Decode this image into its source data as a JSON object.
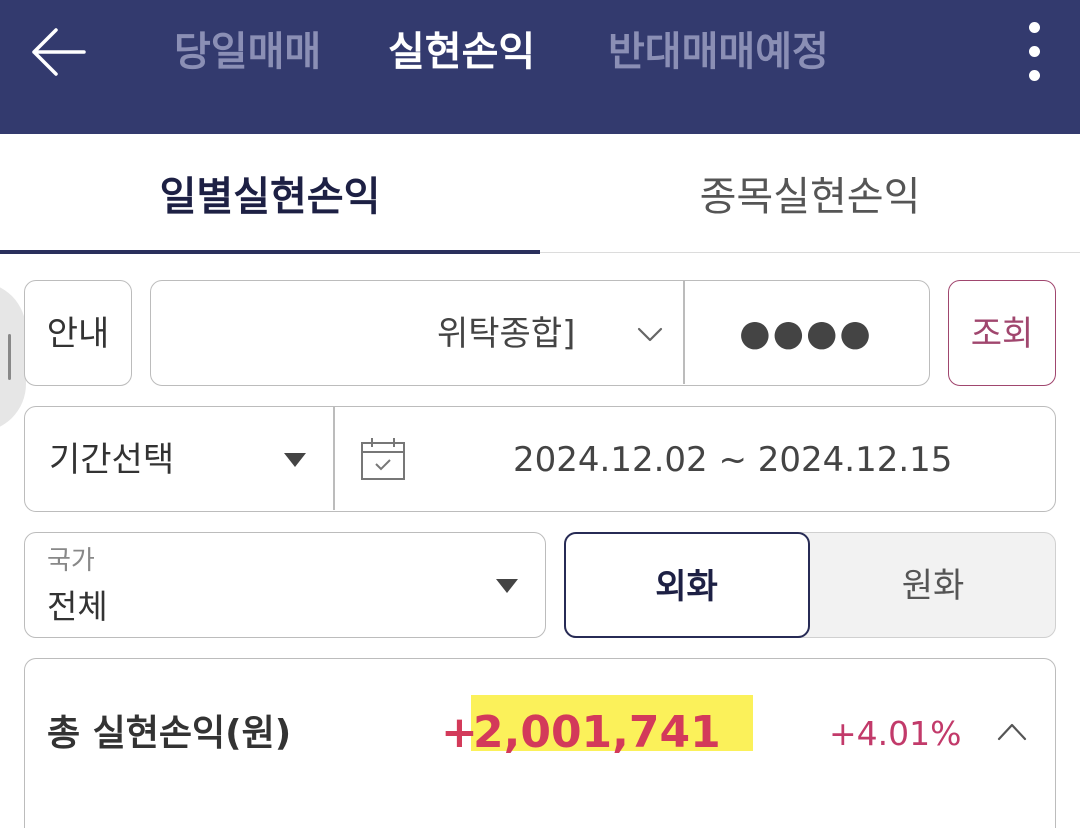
{
  "top_tabs": [
    "당일매매",
    "실현손익",
    "반대매매예정"
  ],
  "sub_tabs": [
    "일별실현손익",
    "종목실현손익"
  ],
  "guide_button": "안내",
  "account": {
    "name": "위탁종합]",
    "password": "●●●●"
  },
  "search_button": "조회",
  "period": {
    "select_label": "기간선택",
    "range": "2024.12.02 ~ 2024.12.15"
  },
  "country": {
    "label": "국가",
    "value": "전체"
  },
  "currency_toggle": [
    "외화",
    "원화"
  ],
  "summary": {
    "label": "총 실현손익(원)",
    "sign": "+",
    "amount": "2,001,741",
    "rate": "+4.01%"
  },
  "colors": {
    "header": "#333a6e",
    "accent": "#a0466e",
    "profit": "#d33a5a",
    "highlight": "#fbf15a"
  },
  "icons": [
    "back-arrow-icon",
    "more-vert-icon",
    "chevron-down-icon",
    "dropdown-triangle-icon",
    "calendar-icon",
    "chevron-up-icon"
  ]
}
